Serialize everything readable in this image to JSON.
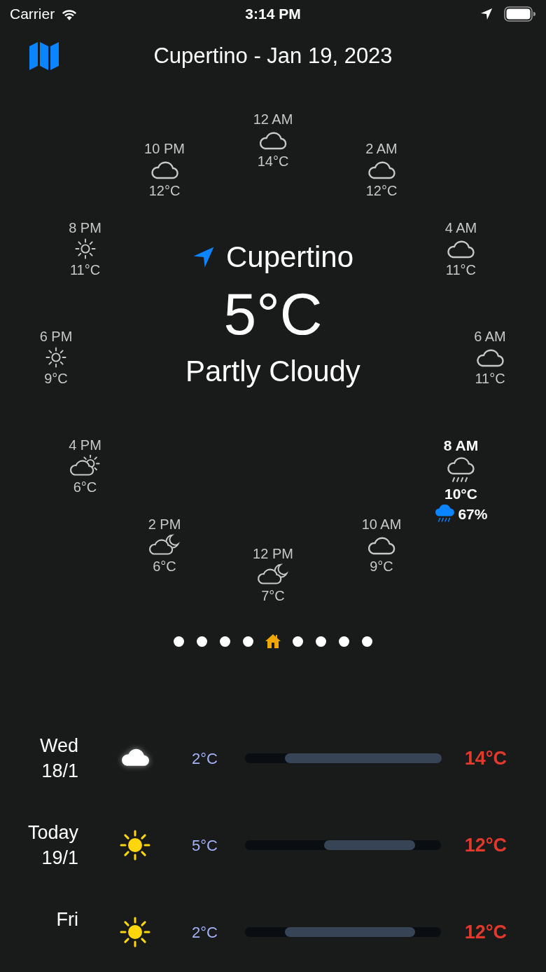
{
  "status_bar": {
    "carrier": "Carrier",
    "time": "3:14 PM"
  },
  "header": {
    "title": "Cupertino - Jan 19, 2023"
  },
  "current": {
    "location": "Cupertino",
    "temperature": "5°C",
    "condition": "Partly Cloudy"
  },
  "hours": [
    {
      "time": "12 AM",
      "kind": "cloud",
      "temp": "14°C",
      "selected": false
    },
    {
      "time": "2 AM",
      "kind": "cloud",
      "temp": "12°C",
      "selected": false
    },
    {
      "time": "4 AM",
      "kind": "cloud",
      "temp": "11°C",
      "selected": false
    },
    {
      "time": "6 AM",
      "kind": "cloud",
      "temp": "11°C",
      "selected": false
    },
    {
      "time": "8 AM",
      "kind": "rain",
      "temp": "10°C",
      "selected": true,
      "precipitation": "67%"
    },
    {
      "time": "10 AM",
      "kind": "cloud",
      "temp": "9°C",
      "selected": false
    },
    {
      "time": "12 PM",
      "kind": "night",
      "temp": "7°C",
      "selected": false
    },
    {
      "time": "2 PM",
      "kind": "night",
      "temp": "6°C",
      "selected": false
    },
    {
      "time": "4 PM",
      "kind": "partly",
      "temp": "6°C",
      "selected": false
    },
    {
      "time": "6 PM",
      "kind": "sun",
      "temp": "9°C",
      "selected": false
    },
    {
      "time": "8 PM",
      "kind": "sun",
      "temp": "11°C",
      "selected": false
    },
    {
      "time": "10 PM",
      "kind": "cloud",
      "temp": "12°C",
      "selected": false
    }
  ],
  "pages": [
    {
      "kind": "dot"
    },
    {
      "kind": "dot"
    },
    {
      "kind": "dot"
    },
    {
      "kind": "dot"
    },
    {
      "kind": "home"
    },
    {
      "kind": "dot"
    },
    {
      "kind": "dot"
    },
    {
      "kind": "dot"
    },
    {
      "kind": "dot"
    }
  ],
  "days": [
    {
      "day": "Wed",
      "date": "18/1",
      "kind": "cloud",
      "low": "2°C",
      "high": "14°C"
    },
    {
      "day": "Today",
      "date": "19/1",
      "kind": "sun",
      "low": "5°C",
      "high": "12°C"
    },
    {
      "day": "Fri",
      "kind": "sun",
      "low": "2°C",
      "high": "12°C"
    }
  ]
}
